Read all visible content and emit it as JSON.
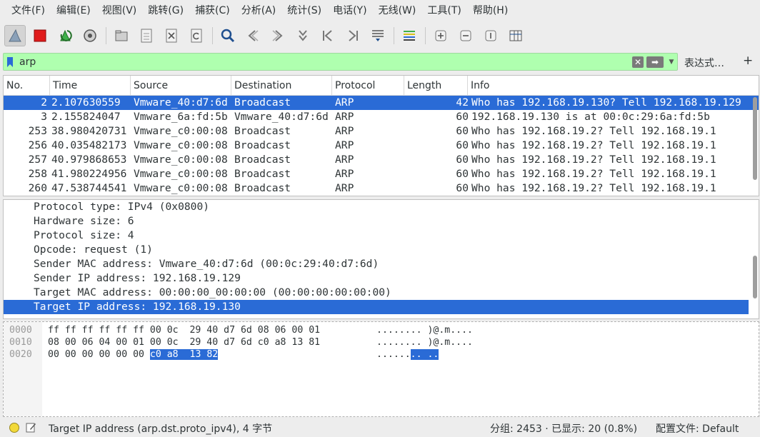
{
  "menu": [
    "文件(F)",
    "编辑(E)",
    "视图(V)",
    "跳转(G)",
    "捕获(C)",
    "分析(A)",
    "统计(S)",
    "电话(Y)",
    "无线(W)",
    "工具(T)",
    "帮助(H)"
  ],
  "toolbar": {
    "icons": [
      "shark-fin-icon",
      "stop-capture-icon",
      "restart-capture-icon",
      "capture-options-icon",
      "open-file-icon",
      "save-file-icon",
      "close-file-icon",
      "reload-file-icon",
      "find-packet-icon",
      "go-back-icon",
      "go-forward-icon",
      "go-to-packet-icon",
      "go-first-icon",
      "go-last-icon",
      "autoscroll-icon",
      "colorize-icon",
      "zoom-in-icon",
      "zoom-out-icon",
      "normal-size-icon",
      "resize-columns-icon"
    ]
  },
  "filter": {
    "value": "arp",
    "expression_label": "表达式…",
    "add_label": "+"
  },
  "packet_list": {
    "columns": [
      "No.",
      "Time",
      "Source",
      "Destination",
      "Protocol",
      "Length",
      "Info"
    ],
    "rows": [
      {
        "no": "2",
        "time": "2.107630559",
        "source": "Vmware_40:d7:6d",
        "destination": "Broadcast",
        "protocol": "ARP",
        "length": "42",
        "info": "Who has 192.168.19.130? Tell 192.168.19.129",
        "selected": true
      },
      {
        "no": "3",
        "time": "2.155824047",
        "source": "Vmware_6a:fd:5b",
        "destination": "Vmware_40:d7:6d",
        "protocol": "ARP",
        "length": "60",
        "info": "192.168.19.130 is at 00:0c:29:6a:fd:5b",
        "selected": false
      },
      {
        "no": "253",
        "time": "38.980420731",
        "source": "Vmware_c0:00:08",
        "destination": "Broadcast",
        "protocol": "ARP",
        "length": "60",
        "info": "Who has 192.168.19.2? Tell 192.168.19.1",
        "selected": false
      },
      {
        "no": "256",
        "time": "40.035482173",
        "source": "Vmware_c0:00:08",
        "destination": "Broadcast",
        "protocol": "ARP",
        "length": "60",
        "info": "Who has 192.168.19.2? Tell 192.168.19.1",
        "selected": false
      },
      {
        "no": "257",
        "time": "40.979868653",
        "source": "Vmware_c0:00:08",
        "destination": "Broadcast",
        "protocol": "ARP",
        "length": "60",
        "info": "Who has 192.168.19.2? Tell 192.168.19.1",
        "selected": false
      },
      {
        "no": "258",
        "time": "41.980224956",
        "source": "Vmware_c0:00:08",
        "destination": "Broadcast",
        "protocol": "ARP",
        "length": "60",
        "info": "Who has 192.168.19.2? Tell 192.168.19.1",
        "selected": false
      },
      {
        "no": "260",
        "time": "47.538744541",
        "source": "Vmware_c0:00:08",
        "destination": "Broadcast",
        "protocol": "ARP",
        "length": "60",
        "info": "Who has 192.168.19.2? Tell 192.168.19.1",
        "selected": false
      }
    ]
  },
  "details": [
    {
      "text": "Protocol type: IPv4 (0x0800)",
      "selected": false
    },
    {
      "text": "Hardware size: 6",
      "selected": false
    },
    {
      "text": "Protocol size: 4",
      "selected": false
    },
    {
      "text": "Opcode: request (1)",
      "selected": false
    },
    {
      "text": "Sender MAC address: Vmware_40:d7:6d (00:0c:29:40:d7:6d)",
      "selected": false
    },
    {
      "text": "Sender IP address: 192.168.19.129",
      "selected": false
    },
    {
      "text": "Target MAC address: 00:00:00_00:00:00 (00:00:00:00:00:00)",
      "selected": false
    },
    {
      "text": "Target IP address: 192.168.19.130",
      "selected": true
    }
  ],
  "bytes": [
    {
      "offset": "0000",
      "hex": "ff ff ff ff ff ff 00 0c  29 40 d7 6d 08 06 00 01",
      "hex_hl": "",
      "hex_tail": "",
      "ascii": "........ )@.m....",
      "ascii_hl": "",
      "ascii_tail": ""
    },
    {
      "offset": "0010",
      "hex": "08 00 06 04 00 01 00 0c  29 40 d7 6d c0 a8 13 81",
      "hex_hl": "",
      "hex_tail": "",
      "ascii": "........ )@.m....",
      "ascii_hl": "",
      "ascii_tail": ""
    },
    {
      "offset": "0020",
      "hex": "00 00 00 00 00 00 ",
      "hex_hl": "c0 a8  13 82",
      "hex_tail": "",
      "ascii": "......",
      "ascii_hl": ".. ..",
      "ascii_tail": ""
    }
  ],
  "status": {
    "text": "Target IP address (arp.dst.proto_ipv4), 4 字节",
    "packets": "分组: 2453 · 已显示: 20 (0.8%)",
    "profile": "配置文件: Default"
  },
  "colors": {
    "selection": "#2a6bd6",
    "filter_ok": "#afffaf",
    "status_led": "#f2d93a"
  }
}
